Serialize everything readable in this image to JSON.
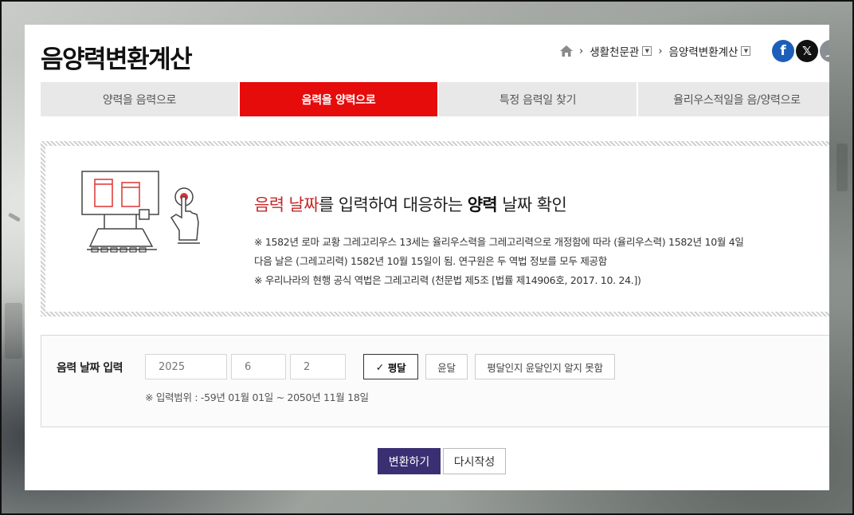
{
  "page": {
    "title": "음양력변환계산"
  },
  "breadcrumb": {
    "home_icon": "home-icon",
    "items": [
      {
        "label": "생활천문관"
      },
      {
        "label": "음양력변환계산"
      }
    ]
  },
  "social": {
    "facebook_icon": "f",
    "twitter_icon": "𝕏",
    "share_icon": "⤴"
  },
  "tabs": [
    {
      "label": "양력을 음력으로",
      "active": false
    },
    {
      "label": "음력을 양력으로",
      "active": true
    },
    {
      "label": "특정 음력일 찾기",
      "active": false
    },
    {
      "label": "율리우스적일을 음/양력으로",
      "active": false
    }
  ],
  "info": {
    "headline": {
      "part1_red": "음력 날짜",
      "part2": "를 입력하여 대응하는 ",
      "part3_bold": "양력",
      "part4": " 날짜 확인"
    },
    "notes": [
      "※ 1582년 로마 교황 그레고리우스 13세는 율리우스력을 그레고리력으로 개정함에 따라 (율리우스력) 1582년 10월 4일",
      "다음 날은 (그레고리력) 1582년 10월 15일이 됨. 연구원은 두 역법 정보를 모두 제공함",
      "※ 우리나라의 현행 공식 역법은 그레고리력 (천문법 제5조 [법률 제14906호, 2017. 10. 24.])"
    ]
  },
  "form": {
    "label": "음력 날짜 입력",
    "year_placeholder": "2025",
    "month_placeholder": "6",
    "day_placeholder": "2",
    "options": [
      {
        "label": "평달",
        "selected": true
      },
      {
        "label": "윤달",
        "selected": false
      },
      {
        "label": "평달인지 윤달인지 알지 못함",
        "selected": false
      }
    ],
    "check_mark": "✓",
    "range_note": "※ 입력범위 : -59년 01월 01일 ~ 2050년 11월 18일"
  },
  "actions": {
    "submit_label": "변환하기",
    "reset_label": "다시작성"
  },
  "colors": {
    "active_tab": "#e60c0c",
    "submit_button": "#3b2f73",
    "accent_red_text": "#c62828"
  }
}
